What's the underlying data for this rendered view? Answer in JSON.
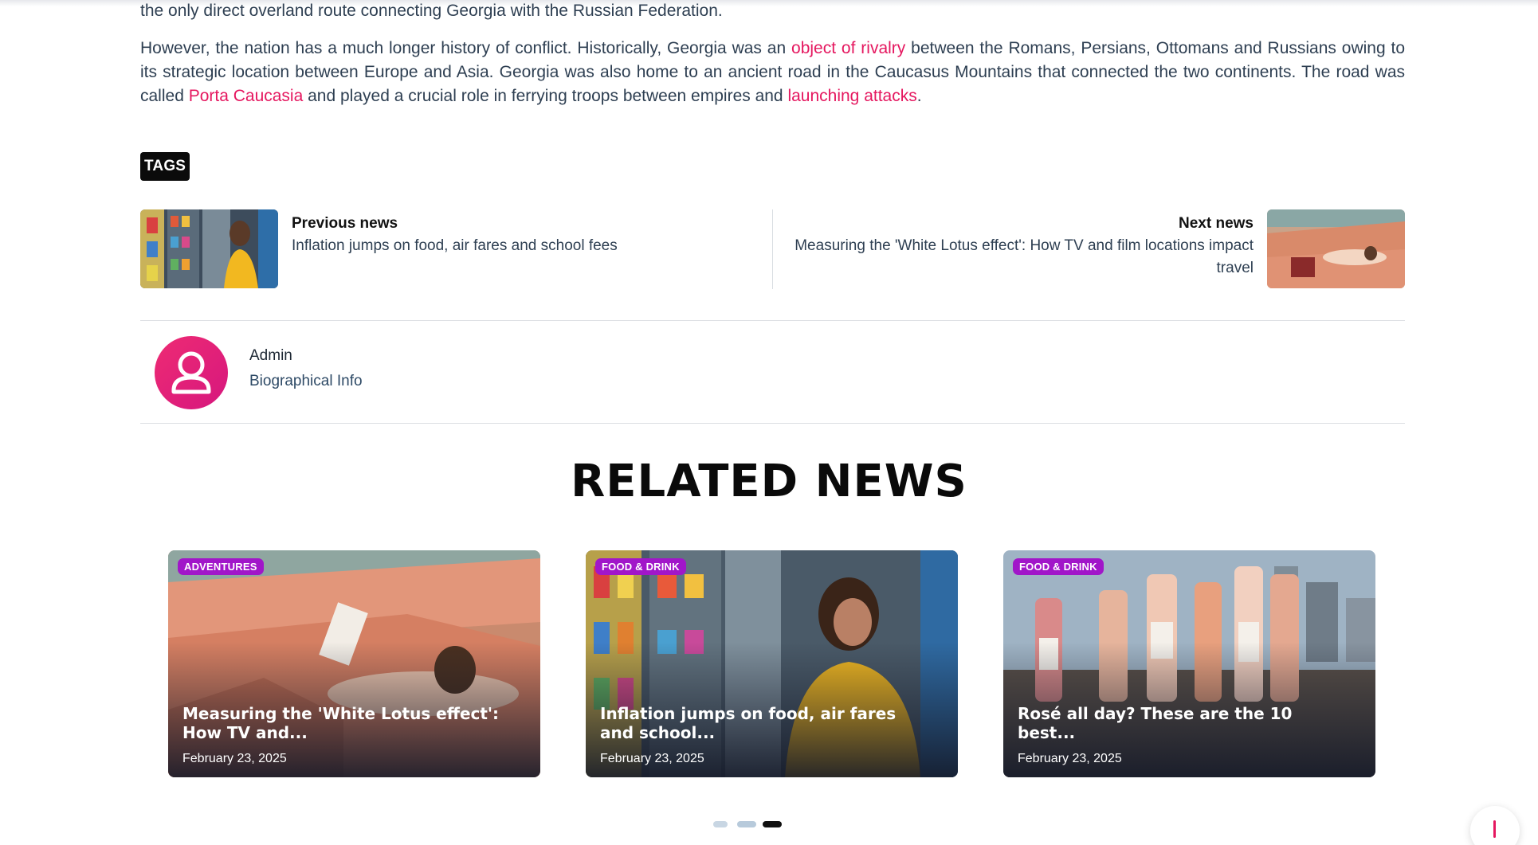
{
  "article": {
    "para1": "the only direct overland route connecting Georgia with the Russian Federation.",
    "para2": {
      "t1": "However, the nation has a much longer history of conflict. Historically, Georgia was an ",
      "link1": "object of rivalry",
      "t2": " between the Romans, Persians, Ottomans and Russians owing to its strategic location between Europe and Asia. Georgia was also home to an ancient road in the Caucasus Mountains that connected the two continents. The road was called ",
      "link2": "Porta Caucasia",
      "t3": " and played a crucial role in ferrying troops between empires and ",
      "link3": "launching attacks",
      "t4": "."
    }
  },
  "tags_label": "TAGS",
  "post_nav": {
    "prev_label": "Previous news",
    "prev_title": "Inflation jumps on food, air fares and school fees",
    "next_label": "Next news",
    "next_title": "Measuring the 'White Lotus effect': How TV and film locations impact travel"
  },
  "author": {
    "name": "Admin",
    "bio": "Biographical Info"
  },
  "related": {
    "heading": "RELATED NEWS",
    "cards": [
      {
        "category": "ADVENTURES",
        "title": "Measuring the 'White Lotus effect': How TV and...",
        "date": "February 23, 2025"
      },
      {
        "category": "FOOD & DRINK",
        "title": "Inflation jumps on food, air fares and school...",
        "date": "February 23, 2025"
      },
      {
        "category": "FOOD & DRINK",
        "title": "Rosé all day? These are the 10 best...",
        "date": "February 23, 2025"
      }
    ]
  },
  "colors": {
    "link": "#e5175f",
    "category_badge": "#a116c9",
    "avatar": "#e8226f"
  },
  "icons": {
    "avatar": "user-icon"
  }
}
